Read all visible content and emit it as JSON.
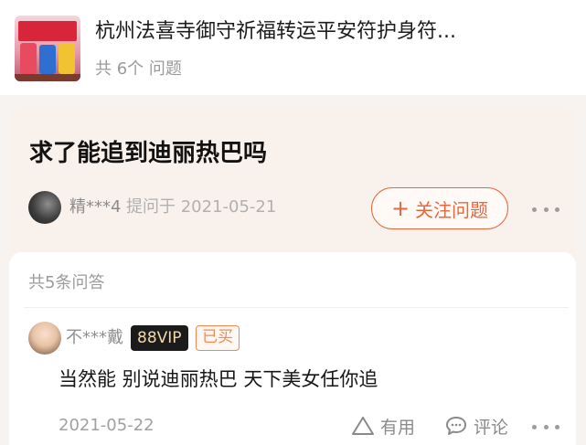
{
  "product": {
    "title": "杭州法喜寺御守祈福转运平安符护身符...",
    "question_count": "共 6个 问题"
  },
  "question": {
    "title": "求了能追到迪丽热巴吗",
    "asker": "精***4",
    "time": "提问于 2021-05-21",
    "follow_plus": "+",
    "follow_label": "关注问题"
  },
  "answers": {
    "count_label": "共5条问答",
    "items": [
      {
        "user": "不***戴",
        "vip": "88VIP",
        "bought": "已买",
        "text": "当然能 别说迪丽热巴 天下美女任你追",
        "time": "2021-05-22",
        "useful_label": "有用",
        "comment_label": "评论"
      }
    ]
  },
  "colors": {
    "accent": "#e8663d",
    "page_bg": "#f6f3f1",
    "question_bg": "#f9f1eb",
    "vip_bg": "#1b1b1b",
    "vip_text": "#f2d9a7"
  },
  "icons": [
    "more-dots-icon",
    "thumbs-up-icon",
    "comment-icon",
    "plus-icon"
  ]
}
